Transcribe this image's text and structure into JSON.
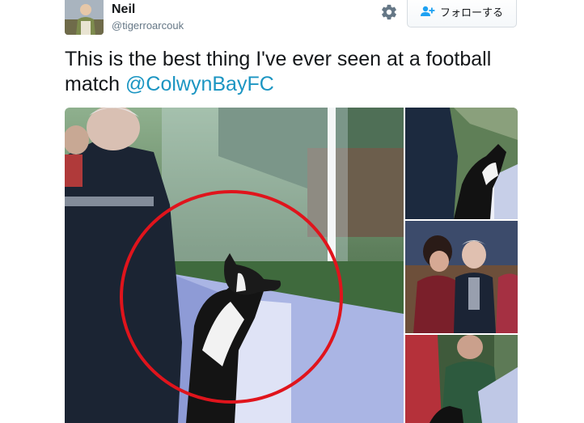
{
  "author": {
    "display_name": "Neil",
    "screen_name": "@tigerroarcouk"
  },
  "actions": {
    "follow_label": "フォローする",
    "gear_icon": "gear-icon",
    "follow_icon": "add-user-icon"
  },
  "tweet": {
    "text": "This is the best thing I've ever seen at a football match ",
    "mention": "@ColwynBayFC"
  },
  "colors": {
    "link": "#1b95c2",
    "text": "#14171a",
    "secondary": "#657786",
    "annotation_circle": "#e0141c"
  }
}
